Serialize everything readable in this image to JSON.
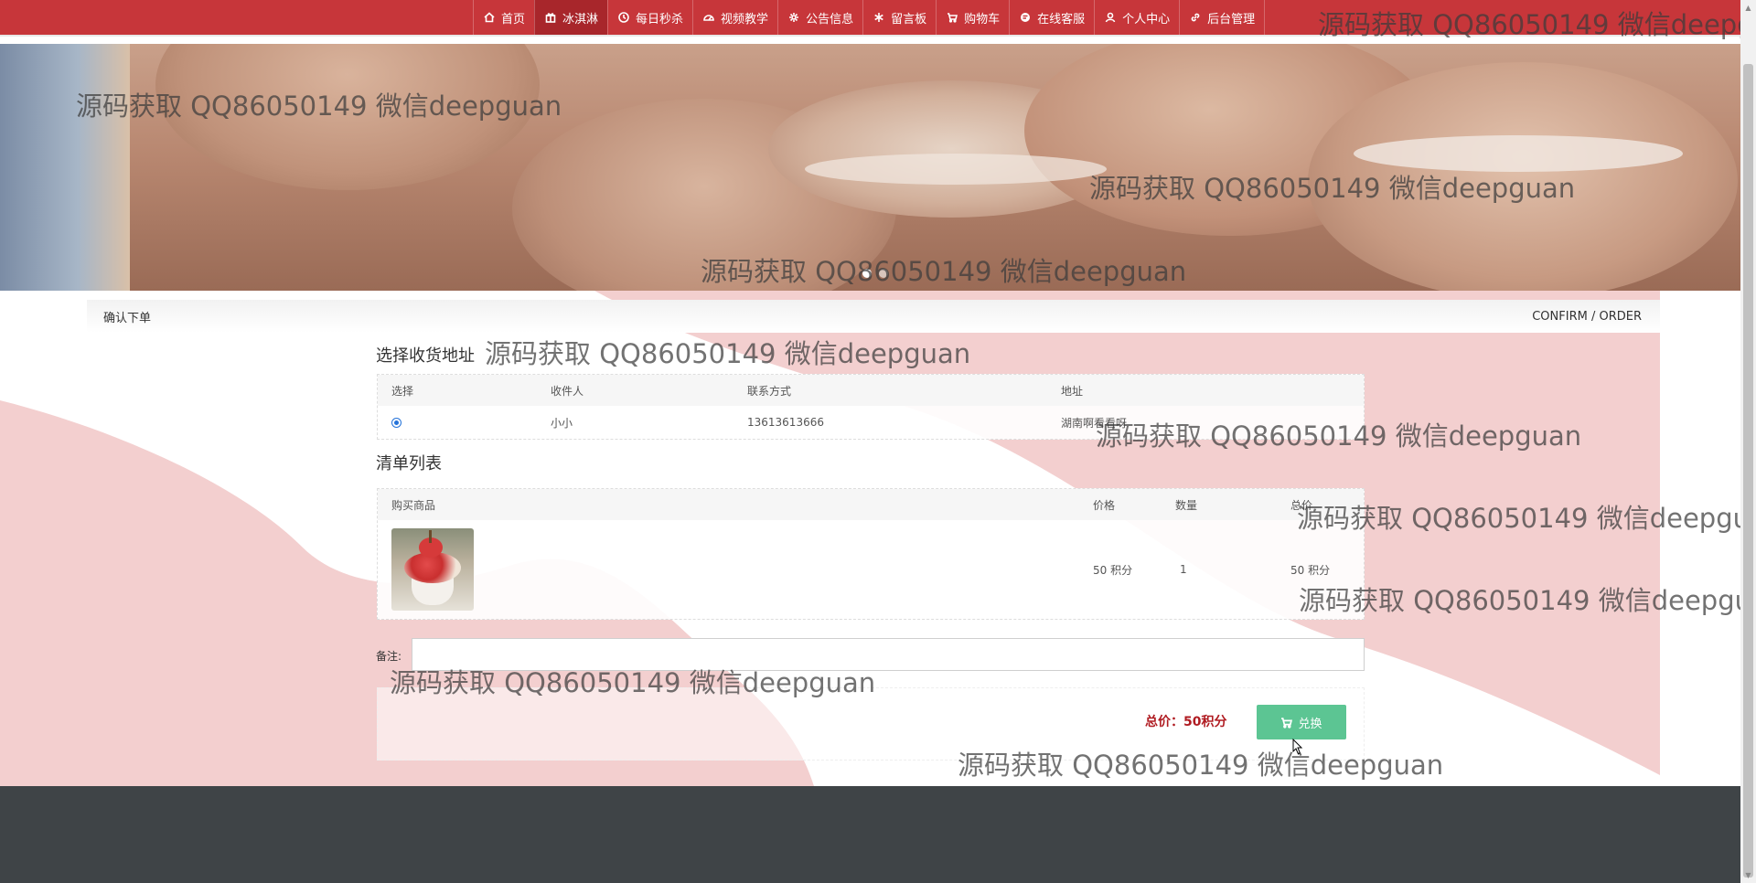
{
  "nav": {
    "items": [
      {
        "label": "首页",
        "icon": "home-icon"
      },
      {
        "label": "冰淇淋",
        "icon": "gift-icon",
        "active": true
      },
      {
        "label": "每日秒杀",
        "icon": "clock-icon"
      },
      {
        "label": "视频教学",
        "icon": "video-icon"
      },
      {
        "label": "公告信息",
        "icon": "gear-icon"
      },
      {
        "label": "留言板",
        "icon": "snowflake-icon"
      },
      {
        "label": "购物车",
        "icon": "cart-icon"
      },
      {
        "label": "在线客服",
        "icon": "chat-icon"
      },
      {
        "label": "个人中心",
        "icon": "user-icon"
      },
      {
        "label": "后台管理",
        "icon": "link-icon"
      }
    ]
  },
  "banner": {
    "slide_count": 3,
    "active_slide": 1
  },
  "breadcrumb": {
    "left": "确认下单",
    "right": "CONFIRM / ORDER"
  },
  "address_section": {
    "title": "选择收货地址",
    "headers": [
      "选择",
      "收件人",
      "联系方式",
      "地址"
    ],
    "rows": [
      {
        "selected": true,
        "recipient": "小小",
        "phone": "13613613666",
        "address": "湖南啊看看呀"
      }
    ]
  },
  "list_section": {
    "title": "清单列表",
    "headers": [
      "购买商品",
      "价格",
      "数量",
      "总价"
    ],
    "items": [
      {
        "image": "ice-cream-sundae",
        "price": "50 积分",
        "quantity": "1",
        "total": "50 积分"
      }
    ]
  },
  "remark": {
    "label": "备注:",
    "value": ""
  },
  "summary": {
    "total_text": "总价：50积分",
    "button_label": "兑换"
  },
  "watermark": {
    "text": "源码获取 QQ86050149 微信deepguan"
  },
  "colors": {
    "nav_bg": "#c7363a",
    "nav_active": "#a8262b",
    "pink_wave": "#f3cfcf",
    "total_red": "#b01c22",
    "button_green": "#5cc593",
    "footer": "#3f4447"
  }
}
